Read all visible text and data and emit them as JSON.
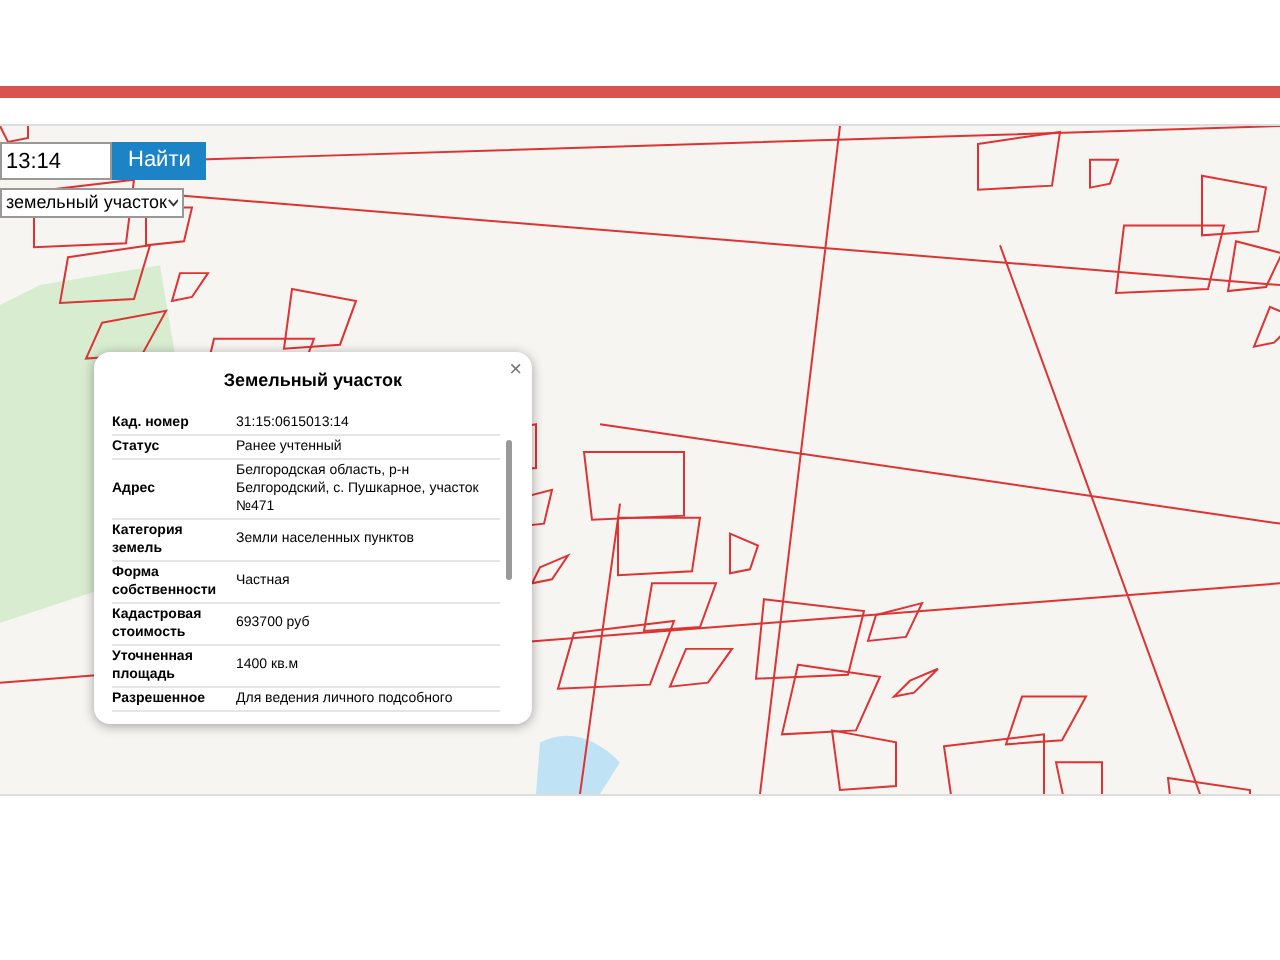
{
  "search": {
    "value": "13:14",
    "button": "Найти"
  },
  "type_select": {
    "value": "земельный участок"
  },
  "popup": {
    "title": "Земельный участок",
    "close": "×",
    "rows": [
      {
        "label": "Кад. номер",
        "value": "31:15:0615013:14"
      },
      {
        "label": "Статус",
        "value": "Ранее учтенный"
      },
      {
        "label": "Адрес",
        "value": "Белгородская область, р-н Белгородский, с. Пушкарное, участок №471"
      },
      {
        "label": "Категория земель",
        "value": "Земли населенных пунктов"
      },
      {
        "label": "Форма собственности",
        "value": "Частная"
      },
      {
        "label": "Кадастровая стоимость",
        "value": "693700 руб"
      },
      {
        "label": "Уточненная площадь",
        "value": "1400 кв.м"
      },
      {
        "label": "Разрешенное",
        "value": "Для ведения личного подсобного"
      }
    ]
  }
}
